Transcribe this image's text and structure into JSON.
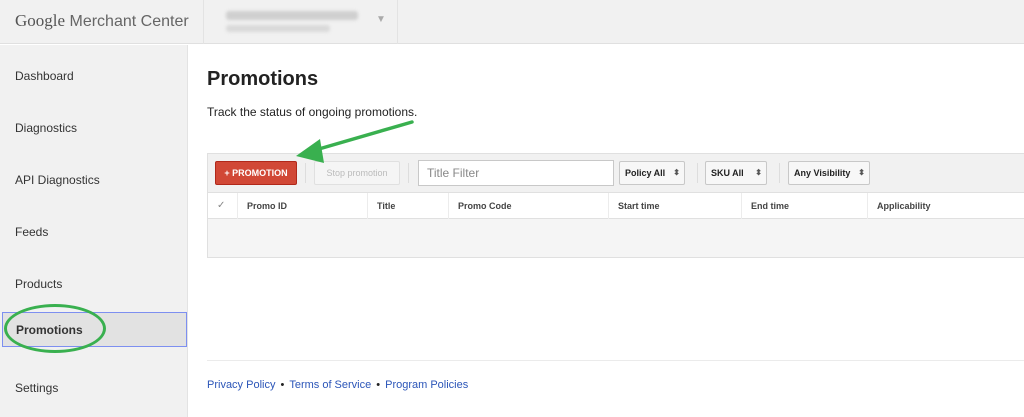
{
  "header": {
    "logo_google": "Google",
    "logo_product": "Merchant Center"
  },
  "sidebar": {
    "items": [
      {
        "label": "Dashboard"
      },
      {
        "label": "Diagnostics"
      },
      {
        "label": "API Diagnostics"
      },
      {
        "label": "Feeds"
      },
      {
        "label": "Products"
      },
      {
        "label": "Promotions",
        "active": true
      },
      {
        "label": "Settings"
      }
    ]
  },
  "main": {
    "title": "Promotions",
    "subtitle": "Track the status of ongoing promotions."
  },
  "toolbar": {
    "add_label": "+ PROMOTION",
    "stop_label": "Stop promotion",
    "filter_placeholder": "Title Filter",
    "policy_label": "Policy All",
    "sku_label": "SKU All",
    "visibility_label": "Any Visibility"
  },
  "table": {
    "columns": [
      "Promo ID",
      "Title",
      "Promo Code",
      "Start time",
      "End time",
      "Applicability"
    ]
  },
  "footer": {
    "links": [
      "Privacy Policy",
      "Terms of Service",
      "Program Policies"
    ]
  },
  "colors": {
    "accent_red": "#d14836",
    "annotation_green": "#39b04f",
    "link_blue": "#2b55b8"
  }
}
